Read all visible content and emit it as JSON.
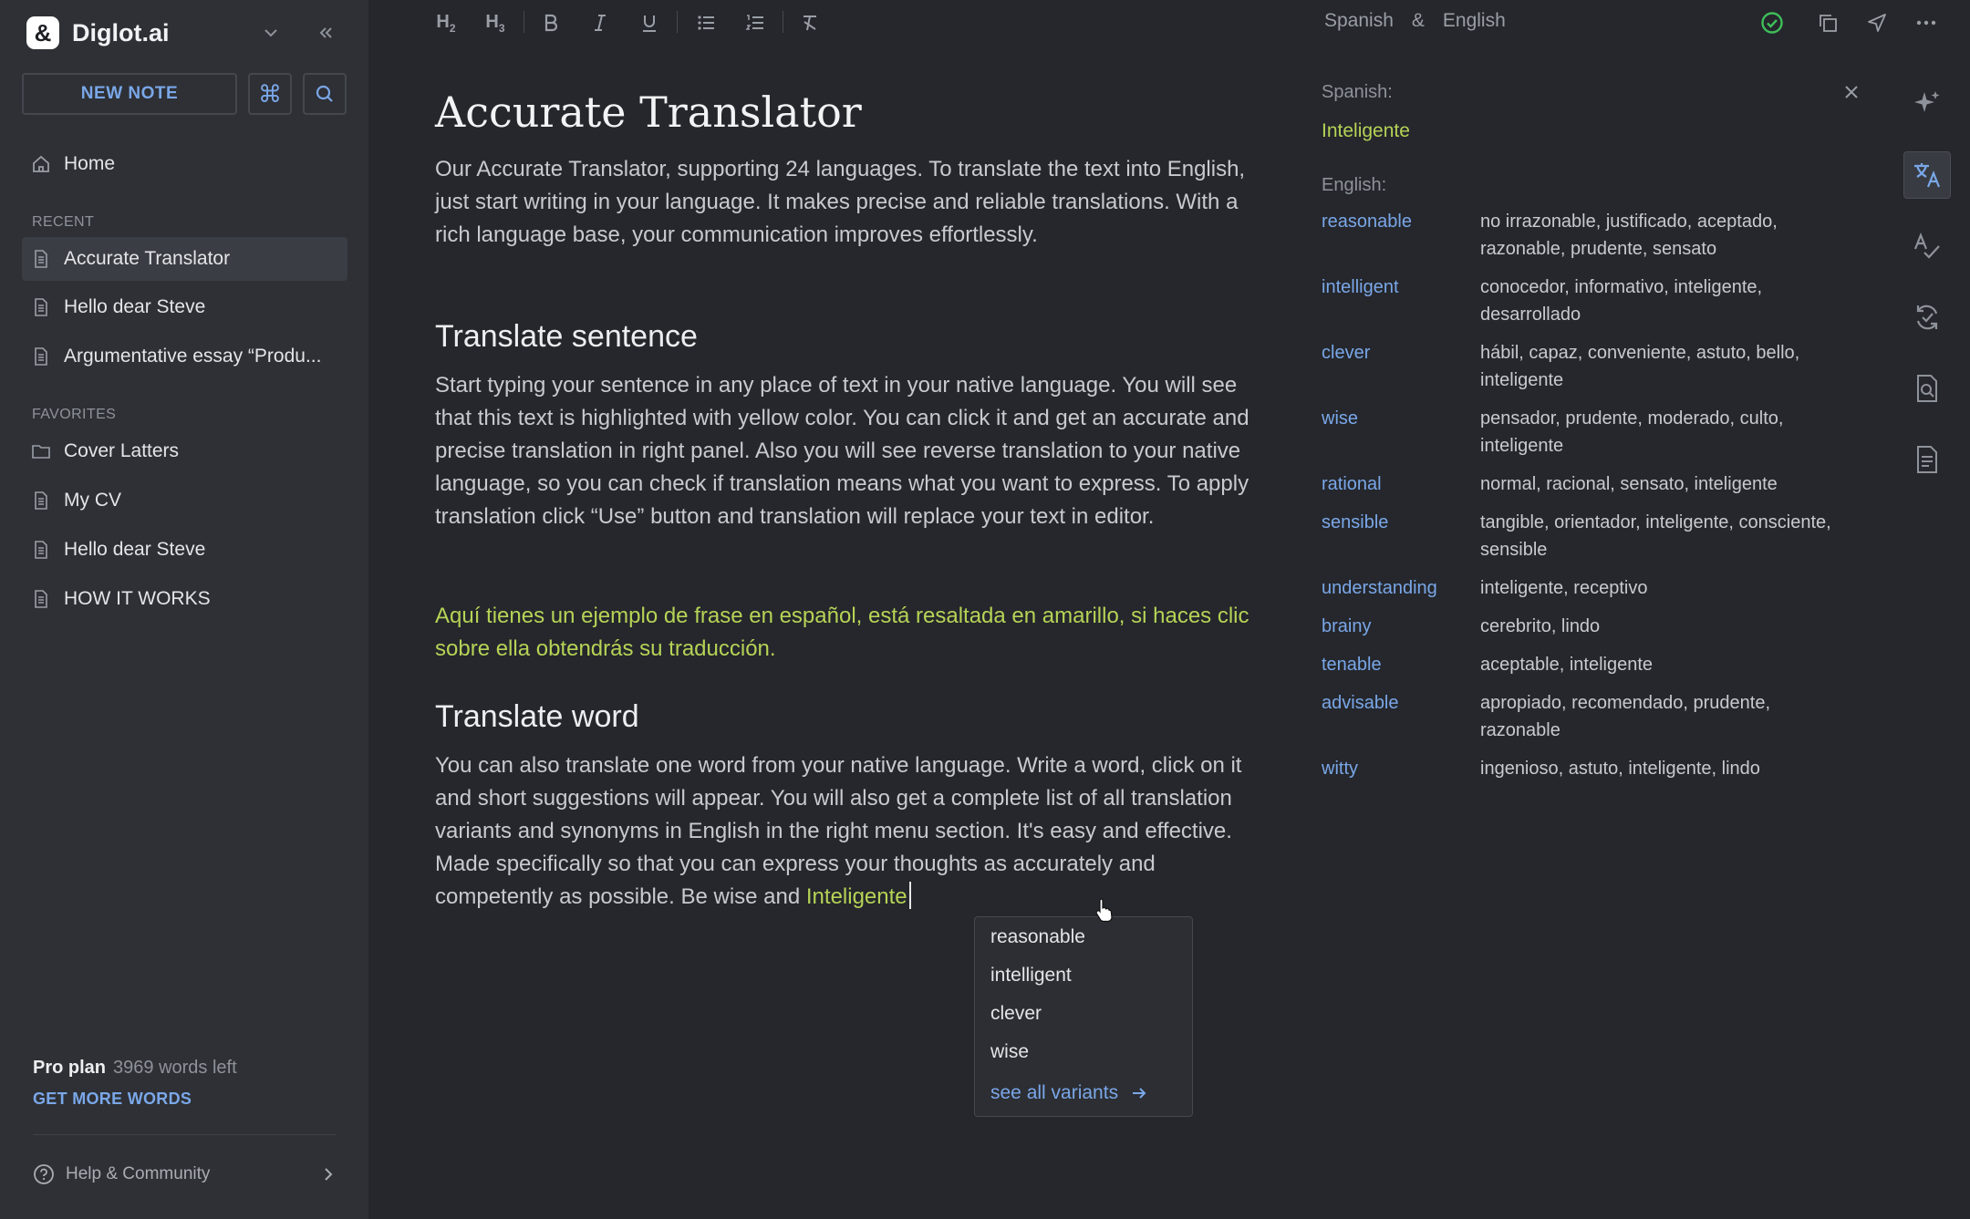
{
  "app": {
    "name": "Diglot.ai",
    "logo_glyph": "&"
  },
  "sidebar": {
    "new_note_label": "NEW NOTE",
    "command_glyph": "⌘",
    "home_label": "Home",
    "recent_header": "RECENT",
    "recent_items": [
      {
        "label": "Accurate Translator",
        "icon": "document-icon",
        "active": true
      },
      {
        "label": "Hello dear Steve",
        "icon": "document-icon",
        "active": false
      },
      {
        "label": "Argumentative essay “Produ...",
        "icon": "document-icon",
        "active": false
      }
    ],
    "favorites_header": "FAVORITES",
    "favorite_items": [
      {
        "label": "Cover Latters",
        "icon": "folder-icon"
      },
      {
        "label": "My CV",
        "icon": "document-icon"
      },
      {
        "label": "Hello dear Steve",
        "icon": "document-icon"
      },
      {
        "label": "HOW IT WORKS",
        "icon": "document-icon"
      }
    ],
    "plan_name": "Pro plan",
    "words_left": "3969 words left",
    "get_more_label": "GET MORE WORDS",
    "help_label": "Help & Community"
  },
  "toolbar": {
    "source_lang": "Spanish",
    "amp": "&",
    "target_lang": "English"
  },
  "document": {
    "title": "Accurate Translator",
    "intro": "Our Accurate Translator, supporting 24 languages. To translate the text into English, just start writing in your language. It makes precise and reliable translations. With a rich language base, your communication improves effortlessly.",
    "section1_heading": "Translate sentence",
    "section1_body": "Start typing your sentence in any place of text in your native language. You will see that this text is highlighted with yellow color. You can click it and get an accurate and precise translation in right panel. Also you will see reverse translation to your native language, so you can check if translation means what you want to express. To apply translation click “Use” button and translation will replace your text in editor.",
    "section1_example": "Aquí tienes un ejemplo de frase en español, está resaltada en amarillo, si haces clic sobre ella obtendrás su traducción.",
    "section2_heading": "Translate word",
    "section2_body": "You can also translate one word from your native language. Write a word, click on it and short suggestions will appear. You will also get a complete list of all translation variants and synonyms in English in the right menu section. It's easy and effective. Made specifically so that you can express your thoughts as accurately and competently as possible. Be wise and ",
    "section2_highlight": "Inteligente"
  },
  "suggestions": {
    "items": [
      "reasonable",
      "intelligent",
      "clever",
      "wise"
    ],
    "see_all_label": "see all variants"
  },
  "panel": {
    "source_label": "Spanish:",
    "source_word": "Inteligente",
    "target_label": "English:",
    "synonyms": [
      {
        "word": "reasonable",
        "translations": "no irrazonable, justificado, aceptado, razonable, prudente, sensato"
      },
      {
        "word": "intelligent",
        "translations": "conocedor, informativo, inteligente, desarrollado"
      },
      {
        "word": "clever",
        "translations": "hábil, capaz, conveniente, astuto, bello, inteligente"
      },
      {
        "word": "wise",
        "translations": "pensador, prudente, moderado, culto, inteligente"
      },
      {
        "word": "rational",
        "translations": "normal, racional, sensato, inteligente"
      },
      {
        "word": "sensible",
        "translations": "tangible, orientador, inteligente, consciente, sensible"
      },
      {
        "word": "understanding",
        "translations": "inteligente, receptivo"
      },
      {
        "word": "brainy",
        "translations": "cerebrito, lindo"
      },
      {
        "word": "tenable",
        "translations": "aceptable, inteligente"
      },
      {
        "word": "advisable",
        "translations": "apropiado, recomendado, prudente, razonable"
      },
      {
        "word": "witty",
        "translations": "ingenioso, astuto, inteligente, lindo"
      }
    ]
  },
  "colors": {
    "accent_blue": "#7aa7e8",
    "highlight_green": "#b6d356",
    "status_green": "#3fbf5a",
    "sidebar_bg": "#2e3035",
    "editor_bg": "#25272c"
  }
}
